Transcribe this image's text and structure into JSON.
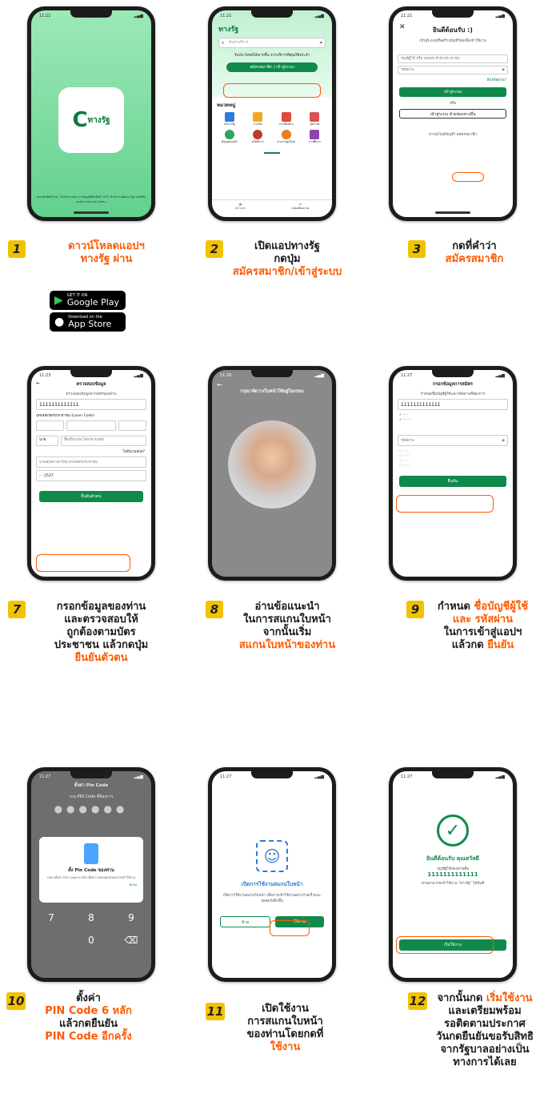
{
  "time": "11:21",
  "phone1": {
    "logo": "ทางรัฐ",
    "footer": "สงวนลิขสิทธิ์ พ.ศ. 2558 ตามพระราชบัญญัติลิขสิทธิ์ 2537 สำนักงานพัฒนารัฐบาลดิจิทัล (องค์การมหาชน) (สพร.)"
  },
  "phone2": {
    "title": "ทางรัฐ",
    "search_placeholder": "ค้นหาบริการ",
    "promo": "รับประโยชน์ได้มากขึ้น จากบริการที่คุณใช้ประจำ",
    "signin": "สมัครสมาชิก / เข้าสู่ระบบ",
    "section": "หมวดหมู่",
    "cats": [
      "บริการรัฐ",
      "การเงิน",
      "การเดินทาง",
      "สุขภาพ",
      "ข้อมูลส่วนตัว",
      "สวัสดิการ",
      "สาธารณูปโภค",
      "การศึกษา"
    ],
    "nav": [
      "หน้าแรก",
      "กล่องข้อความ"
    ]
  },
  "phone3": {
    "welcome": "ยินดีต้อนรับ :)",
    "sub": "เข้าสู่ระบบหรือสร้างบัญชีใหม่เพื่อเข้าใช้งาน",
    "user_ph": "บัญชีผู้ใช้ หรือ เลขประจำตัวประชาชน",
    "pass_ph": "รหัสผ่าน",
    "forgot": "ลืมรหัสผ่าน?",
    "login": "เข้าสู่ระบบ",
    "or": "หรือ",
    "alt": "เข้าสู่ระบบ ด้วยช่องทางอื่น",
    "register": "หากยังไม่มีบัญชี? สมัครสมาชิก"
  },
  "phone7": {
    "header": "ตรวจสอบข้อมูล",
    "sub": "ตรวจสอบข้อมูลจากบัตรของท่าน",
    "id": "1111111111111",
    "laser_label": "เลขหลังบัตรประชาชน (Laser Code)",
    "title_sel": "นาย",
    "name_ph": "ชื่อจริงภาษาไทย ตามบัตร",
    "no_lastname": "ไม่มีนามสกุล?",
    "lastname_ph": "นามสกุลภาษาไทย ตามบัตรประชาชน",
    "dob": "- - 2537",
    "confirm": "ยืนยันตัวตน"
  },
  "phone8": {
    "prompt": "กรุณาจัดวางใบหน้าให้อยู่ในกรอบ"
  },
  "phone9": {
    "header": "กรอกข้อมูลการสมัคร",
    "sub": "กำหนดชื่อบัญชีผู้ใช้และรหัสผ่านที่ต้องการ",
    "user": "1111111111111",
    "pass_ph": "รหัสผ่าน",
    "confirm": "ยืนยัน"
  },
  "phone10": {
    "title": "ตั้งค่า Pin Code",
    "sub": "ระบุ PIN Code ที่ต้องการ",
    "modal_title": "ตั้ง Pin Code ของท่าน",
    "modal_text": "กรุณาตั้งค่า PIN Code 6 หลัก เพื่อความปลอดภัยของการเข้าใช้งาน",
    "ok": "ตกลง",
    "keys": [
      "7",
      "8",
      "9",
      "0"
    ]
  },
  "phone11": {
    "title": "เปิดการใช้งานสแกนใบหน้า",
    "text": "เปิดการใช้งานสแกนใบหน้า เพื่อการเข้าใช้งานอย่างรวดเร็วและปลอดภัยยิ่งขึ้น",
    "skip": "ข้าม",
    "use": "ใช้งาน"
  },
  "phone12": {
    "welcome": "ยินดีต้อนรับ คุณสวัสดี",
    "user_label": "บัญชีผู้ใช้ของท่านคือ",
    "user": "1111111111111",
    "hint": "ท่านสามารถเข้าใช้งาน \"ทางรัฐ\" ได้ทันที",
    "start": "เริ่มใช้งาน"
  },
  "steps": [
    {
      "n": "1",
      "lines": [
        "ดาวน์โหลดแอปฯ",
        "ทางรัฐ ผ่าน"
      ]
    },
    {
      "n": "2",
      "lines": [
        "เปิดแอปทางรัฐ",
        "กดปุ่ม"
      ],
      "orange": [
        "สมัครสมาชิก/เข้าสู่ระบบ"
      ]
    },
    {
      "n": "3",
      "lines": [
        "กดที่คำว่า"
      ],
      "orange": [
        "สมัครสมาชิก"
      ]
    },
    {
      "n": "7",
      "lines": [
        "กรอกข้อมูลของท่าน",
        "และตรวจสอบให้",
        "ถูกต้องตามบัตร",
        "ประชาชน แล้วกดปุ่ม"
      ],
      "orange": [
        "ยืนยันตัวตน"
      ]
    },
    {
      "n": "8",
      "lines": [
        "อ่านข้อแนะนำ",
        "ในการสแกนใบหน้า",
        "จากนั้นเริ่ม"
      ],
      "orange": [
        "สแกนใบหน้าของท่าน"
      ]
    },
    {
      "n": "9",
      "l1": "กำหนด",
      "o1": "ชื่อบัญชีผู้ใช้",
      "o2": "และ รหัสผ่าน",
      "l2": "ในการเข้าสู่แอปฯ",
      "l3": "แล้วกด",
      "o3": "ยืนยัน"
    },
    {
      "n": "10",
      "lines": [
        "ตั้งค่า"
      ],
      "orange": [
        "PIN Code 6 หลัก"
      ],
      "lines2": [
        "แล้วกดยืนยัน"
      ],
      "orange2": [
        "PIN Code อีกครั้ง"
      ]
    },
    {
      "n": "11",
      "lines": [
        "เปิดใช้งาน",
        "การสแกนใบหน้า",
        "ของท่านโดยกดที่"
      ],
      "orange": [
        "ใช้งาน"
      ]
    },
    {
      "n": "12",
      "l1": "จากนั้นกด",
      "o1": "เริ่มใช้งาน",
      "lines": [
        "และเตรียมพร้อม",
        "รอติดตามประกาศ",
        "วันกดยืนยันขอรับสิทธิ",
        "จากรัฐบาลอย่างเป็น",
        "ทางการได้เลย"
      ]
    }
  ],
  "badges": {
    "gp_small": "GET IT ON",
    "gp_big": "Google Play",
    "as_small": "Download on the",
    "as_big": "App Store"
  }
}
